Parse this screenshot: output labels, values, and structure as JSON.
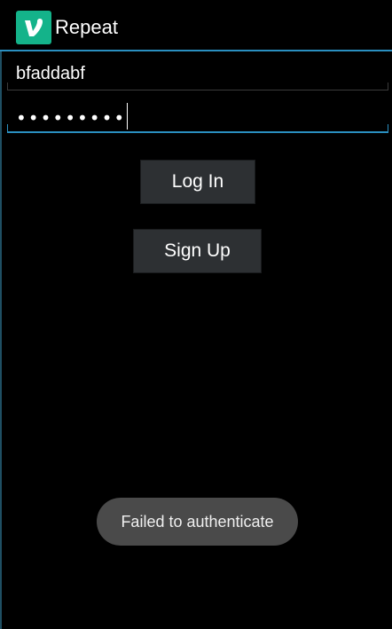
{
  "app": {
    "title": "Repeat",
    "icon": "vine-logo-icon",
    "accent_color": "#2a8fc0",
    "icon_color": "#14b38a"
  },
  "login_form": {
    "username_value": "bfaddabf",
    "password_masked": "•••••••••"
  },
  "buttons": {
    "login_label": "Log In",
    "signup_label": "Sign Up"
  },
  "toast": {
    "message": "Failed to authenticate"
  }
}
